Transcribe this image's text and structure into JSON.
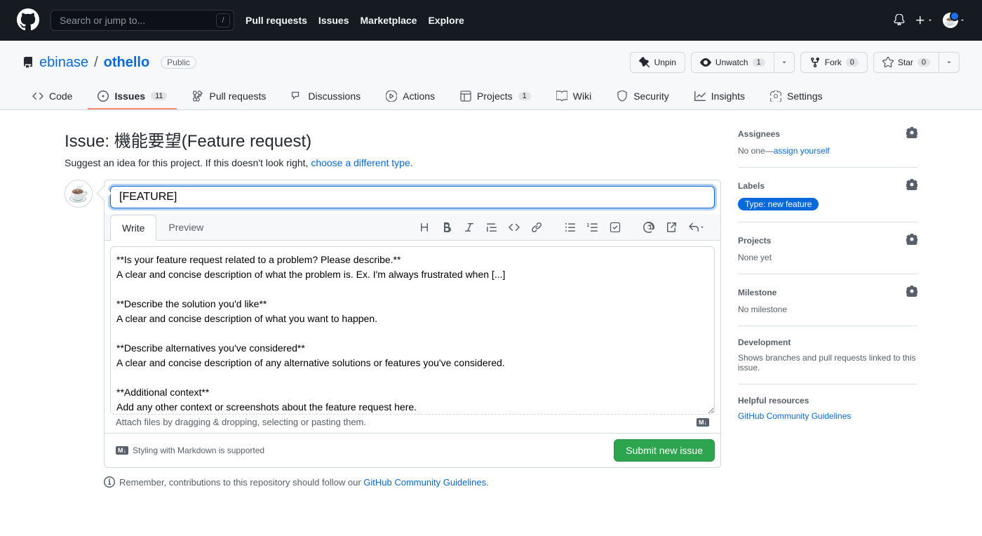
{
  "header": {
    "search_placeholder": "Search or jump to...",
    "nav": [
      "Pull requests",
      "Issues",
      "Marketplace",
      "Explore"
    ]
  },
  "repo": {
    "owner": "ebinase",
    "name": "othello",
    "visibility": "Public",
    "actions": {
      "unpin": "Unpin",
      "unwatch": "Unwatch",
      "watch_count": "1",
      "fork": "Fork",
      "fork_count": "0",
      "star": "Star",
      "star_count": "0"
    },
    "tabs": {
      "code": "Code",
      "issues": "Issues",
      "issues_count": "11",
      "pulls": "Pull requests",
      "discussions": "Discussions",
      "actions": "Actions",
      "projects": "Projects",
      "projects_count": "1",
      "wiki": "Wiki",
      "security": "Security",
      "insights": "Insights",
      "settings": "Settings"
    }
  },
  "issue": {
    "heading": "Issue: 機能要望(Feature request)",
    "subtitle_prefix": "Suggest an idea for this project. If this doesn't look right, ",
    "subtitle_link": "choose a different type.",
    "title_value": "[FEATURE]",
    "tabs": {
      "write": "Write",
      "preview": "Preview"
    },
    "body": "**Is your feature request related to a problem? Please describe.**\nA clear and concise description of what the problem is. Ex. I'm always frustrated when [...]\n\n**Describe the solution you'd like**\nA clear and concise description of what you want to happen.\n\n**Describe alternatives you've considered**\nA clear and concise description of any alternative solutions or features you've considered.\n\n**Additional context**\nAdd any other context or screenshots about the feature request here.",
    "attach_hint": "Attach files by dragging & dropping, selecting or pasting them.",
    "md_hint": "Styling with Markdown is supported",
    "submit": "Submit new issue",
    "contrib_prefix": "Remember, contributions to this repository should follow our ",
    "contrib_link": "GitHub Community Guidelines."
  },
  "sidebar": {
    "assignees": {
      "title": "Assignees",
      "body_prefix": "No one—",
      "body_link": "assign yourself"
    },
    "labels": {
      "title": "Labels",
      "pill": "Type: new feature"
    },
    "projects": {
      "title": "Projects",
      "body": "None yet"
    },
    "milestone": {
      "title": "Milestone",
      "body": "No milestone"
    },
    "development": {
      "title": "Development",
      "body": "Shows branches and pull requests linked to this issue."
    },
    "help": {
      "title": "Helpful resources",
      "link": "GitHub Community Guidelines"
    }
  }
}
